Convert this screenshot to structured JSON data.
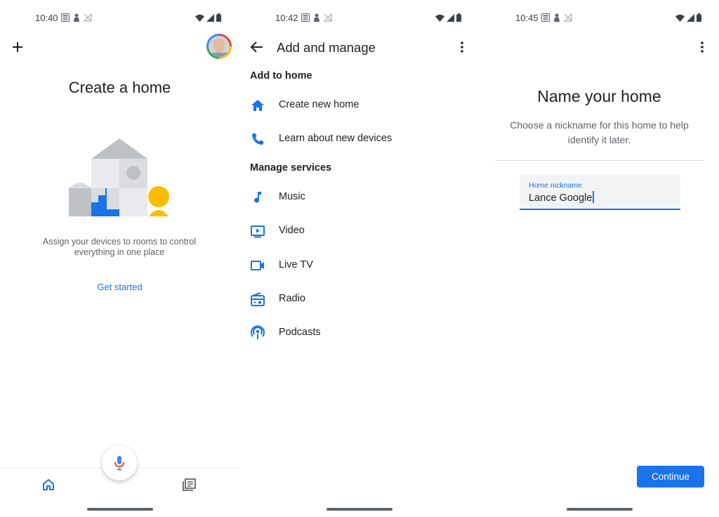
{
  "screens": [
    {
      "status": {
        "time": "10:40"
      },
      "title": "Create a home",
      "description": "Assign your devices to rooms to control everything in one place",
      "cta": "Get started",
      "icons": {
        "add": "plus-icon",
        "account": "avatar",
        "assistant": "mic-icon",
        "home_tab": "home-icon",
        "feed_tab": "feed-icon"
      }
    },
    {
      "status": {
        "time": "10:42"
      },
      "title": "Add and manage",
      "sections": [
        {
          "heading": "Add to home",
          "items": [
            {
              "label": "Create new home",
              "icon": "home-icon"
            },
            {
              "label": "Learn about new devices",
              "icon": "phone-icon"
            }
          ]
        },
        {
          "heading": "Manage services",
          "items": [
            {
              "label": "Music",
              "icon": "music-note-icon"
            },
            {
              "label": "Video",
              "icon": "video-icon"
            },
            {
              "label": "Live TV",
              "icon": "live-tv-icon"
            },
            {
              "label": "Radio",
              "icon": "radio-icon"
            },
            {
              "label": "Podcasts",
              "icon": "podcast-icon"
            }
          ]
        }
      ]
    },
    {
      "status": {
        "time": "10:45"
      },
      "title": "Name your home",
      "description": "Choose a nickname for this home to help identify it later.",
      "field": {
        "label": "Home nickname",
        "value": "Lance Google"
      },
      "button": "Continue"
    }
  ],
  "colors": {
    "accent": "#1a73e8",
    "text": "#202124",
    "secondary": "#5f6368",
    "yellow": "#fbbc04",
    "gray": "#dadce0"
  }
}
